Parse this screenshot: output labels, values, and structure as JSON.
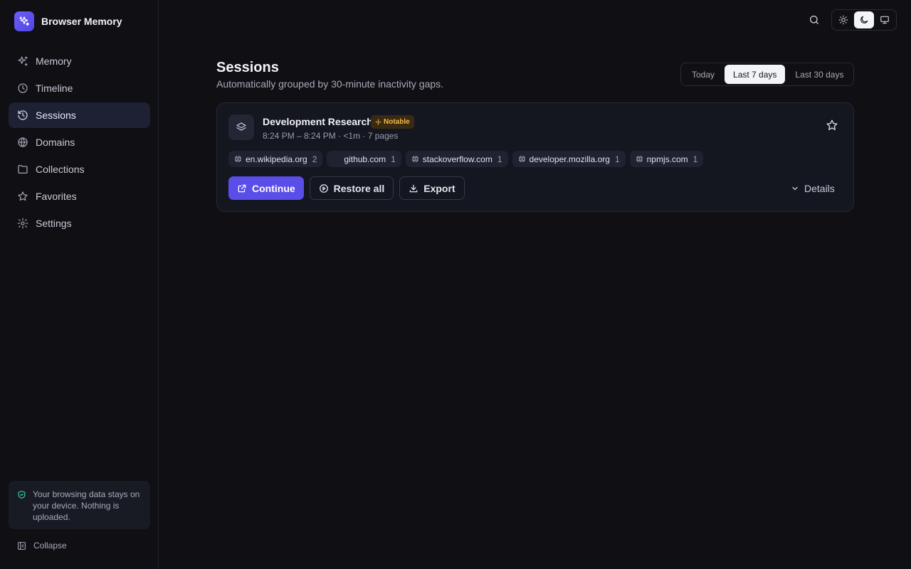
{
  "app": {
    "name": "Browser Memory"
  },
  "sidebar": {
    "items": [
      {
        "label": "Memory",
        "icon": "sparkles-icon"
      },
      {
        "label": "Timeline",
        "icon": "clock-icon"
      },
      {
        "label": "Sessions",
        "icon": "history-icon",
        "active": true
      },
      {
        "label": "Domains",
        "icon": "globe-icon"
      },
      {
        "label": "Collections",
        "icon": "folder-icon"
      },
      {
        "label": "Favorites",
        "icon": "star-icon"
      },
      {
        "label": "Settings",
        "icon": "gear-icon"
      }
    ],
    "privacy_note": "Your browsing data stays on your device. Nothing is uploaded.",
    "collapse_label": "Collapse"
  },
  "header": {
    "title": "Sessions",
    "subtitle": "Automatically grouped by 30-minute inactivity gaps."
  },
  "range": {
    "options": [
      "Today",
      "Last 7 days",
      "Last 30 days"
    ],
    "selected": "Last 7 days"
  },
  "theme": {
    "options": [
      "light",
      "dark",
      "system"
    ],
    "selected": "dark"
  },
  "session": {
    "title": "Development Research",
    "badge": "Notable",
    "meta": "8:24 PM – 8:24 PM · <1m · 7 pages",
    "domains": [
      {
        "name": "en.wikipedia.org",
        "count": "2"
      },
      {
        "name": "github.com",
        "count": "1"
      },
      {
        "name": "stackoverflow.com",
        "count": "1"
      },
      {
        "name": "developer.mozilla.org",
        "count": "1"
      },
      {
        "name": "npmjs.com",
        "count": "1"
      }
    ],
    "actions": {
      "continue": "Continue",
      "restore": "Restore all",
      "export": "Export",
      "details": "Details"
    }
  },
  "colors": {
    "accent": "#5b4ee8",
    "badge_text": "#f5b84a",
    "shield": "#34d399"
  }
}
